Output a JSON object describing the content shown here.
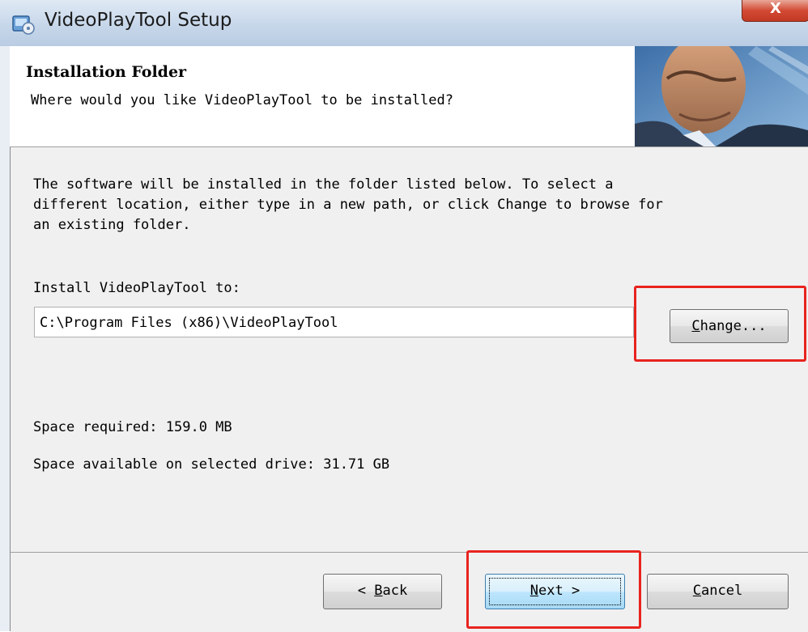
{
  "window": {
    "title": "VideoPlayTool Setup",
    "close_label": "X"
  },
  "header": {
    "title": "Installation Folder",
    "subtitle": "Where would you like VideoPlayTool to be installed?"
  },
  "body": {
    "description": "The software will be installed in the folder listed below. To select a\ndifferent location, either type in a new path, or click Change to browse for\nan existing folder.",
    "install_label": "Install VideoPlayTool to:",
    "install_path": "C:\\Program Files (x86)\\VideoPlayTool",
    "change_button": {
      "mnemonic": "C",
      "rest": "hange..."
    },
    "space_required": "Space required: 159.0 MB",
    "space_available": "Space available on selected drive: 31.71 GB"
  },
  "footer": {
    "back_button": {
      "prefix": "< ",
      "mnemonic": "B",
      "rest": "ack"
    },
    "next_button": {
      "mnemonic": "N",
      "rest": "ext >"
    },
    "cancel_button": {
      "mnemonic": "C",
      "rest": "ancel"
    }
  },
  "annotations": {
    "highlight_color": "#e8231f"
  },
  "icons": [
    "installer-icon",
    "close-icon"
  ]
}
